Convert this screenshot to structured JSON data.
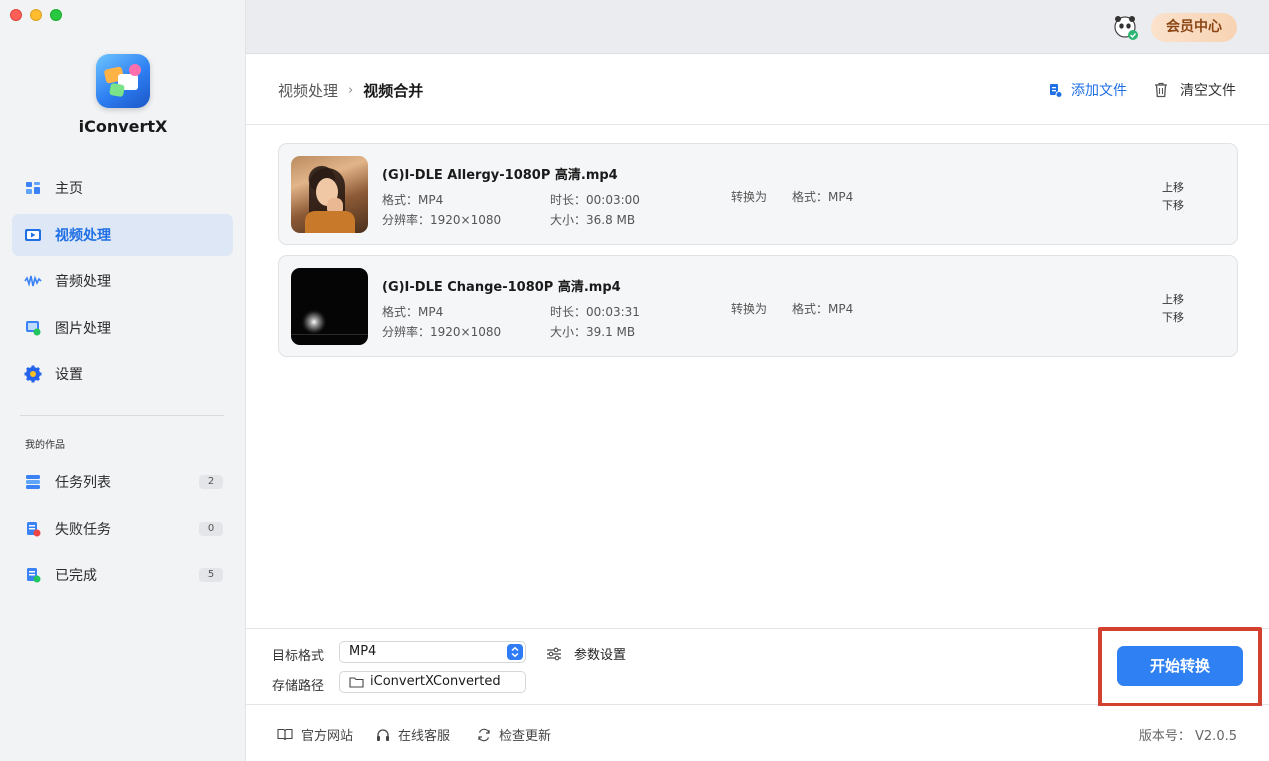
{
  "app": {
    "name": "iConvertX"
  },
  "topbar": {
    "vip_label": "会员中心"
  },
  "sidebar": {
    "nav": [
      {
        "label": "主页"
      },
      {
        "label": "视频处理"
      },
      {
        "label": "音频处理"
      },
      {
        "label": "图片处理"
      },
      {
        "label": "设置"
      }
    ],
    "section_label": "我的作品",
    "works": [
      {
        "label": "任务列表",
        "count": "2"
      },
      {
        "label": "失败任务",
        "count": "0"
      },
      {
        "label": "已完成",
        "count": "5"
      }
    ]
  },
  "header": {
    "crumb_parent": "视频处理",
    "crumb_separator": "›",
    "crumb_current": "视频合并",
    "add_file": "添加文件",
    "clear_file": "清空文件"
  },
  "files": [
    {
      "name": "(G)I-DLE Allergy-1080P 高清.mp4",
      "format": "格式：MP4",
      "resolution": "分辨率：1920×1080",
      "duration": "时长：00:03:00",
      "size": "大小：36.8 MB",
      "convert_to": "转换为",
      "target": "格式：MP4",
      "move_up": "上移",
      "move_down": "下移"
    },
    {
      "name": "(G)I-DLE Change-1080P 高清.mp4",
      "format": "格式：MP4",
      "resolution": "分辨率：1920×1080",
      "duration": "时长：00:03:31",
      "size": "大小：39.1 MB",
      "convert_to": "转换为",
      "target": "格式：MP4",
      "move_up": "上移",
      "move_down": "下移"
    }
  ],
  "settings": {
    "format_label": "目标格式",
    "format_value": "MP4",
    "path_label": "存储路径",
    "path_value": "iConvertXConverted",
    "params_label": "参数设置",
    "start_label": "开始转换"
  },
  "footer": {
    "site": "官方网站",
    "support": "在线客服",
    "update": "检查更新",
    "version": "版本号： V2.0.5"
  },
  "colors": {
    "accent": "#2f80f3",
    "active_nav_bg": "#dde7f6",
    "highlight_frame": "#d2402e",
    "vip_text": "#8a4514"
  },
  "icons": {
    "home": "home-icon",
    "video": "video-icon",
    "audio": "audio-wave-icon",
    "image": "image-icon",
    "settings": "gear-icon",
    "tasks": "task-list-icon",
    "failed": "failed-task-icon",
    "done": "completed-icon"
  }
}
